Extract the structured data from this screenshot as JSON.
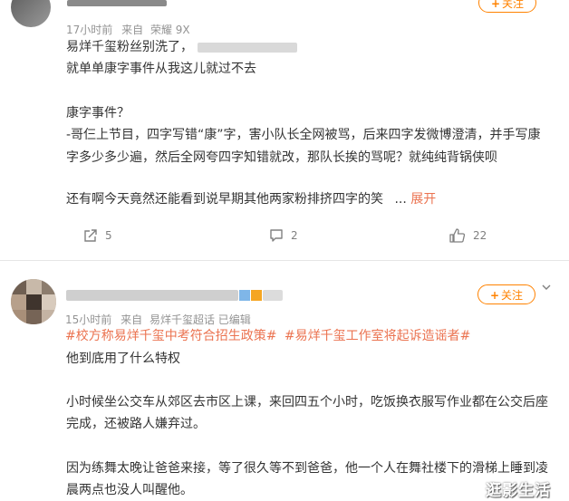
{
  "post1": {
    "meta": {
      "time": "17小时前",
      "source_prefix": "来自",
      "source": "荣耀 9X"
    },
    "follow_label": "关注",
    "lines": [
      "易烊千玺粉丝别洗了，",
      "就单单康字事件从我这儿就过不去",
      "康字事件？",
      "-哥仨上节目，四字写错“康”字，害小队长全网被骂，后来四字发微博澄清，并手写康",
      "字多少多少遍，然后全网夸四字知错就改，那队长挨的骂呢？就纯纯背锅侠呗",
      "还有啊今天竟然还能看到说早期其他两家粉排挤四字的笑"
    ],
    "ellipsis": "...",
    "expand_label": "展开",
    "actions": {
      "share_count": "5",
      "comment_count": "2",
      "like_count": "22"
    }
  },
  "post2": {
    "meta": {
      "time": "15小时前",
      "source_prefix": "来自",
      "source": "易烊千玺超话 已编辑"
    },
    "follow_label": "关注",
    "tags": [
      "#校方称易烊千玺中考符合招生政策#",
      "#易烊千玺工作室将起诉造谣者#"
    ],
    "lines": [
      "他到底用了什么特权",
      "小时候坐公交车从郊区去市区上课，来回四五个小时，吃饭换衣服写作业都在公交后座",
      "完成，还被路人嫌弃过。",
      "因为练舞太晚让爸爸来接，等了很久等不到爸爸，他一个人在舞社楼下的滑梯上睡到凌",
      "晨两点也没人叫醒他。"
    ]
  },
  "watermark": "逛影生活",
  "colors": {
    "accent": "#ff8200",
    "tag": "#eb7350",
    "meta": "#939393",
    "text": "#333333"
  }
}
